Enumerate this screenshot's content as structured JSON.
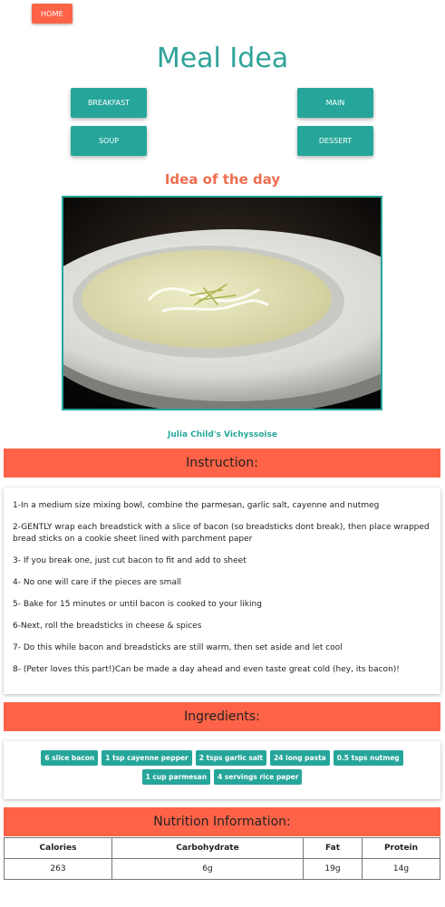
{
  "nav": {
    "home_label": "HOME"
  },
  "header": {
    "title": "Meal Idea"
  },
  "categories": [
    {
      "label": "BREAKFAST"
    },
    {
      "label": "MAIN"
    },
    {
      "label": "SOUP"
    },
    {
      "label": "DESSERT"
    }
  ],
  "idea": {
    "heading": "Idea of the day",
    "dish_name": "Julia Child's Vichyssoise"
  },
  "instructions": {
    "heading": "Instruction:",
    "steps": [
      "1-In a medium size mixing bowl, combine the parmesan, garlic salt, cayenne and nutmeg",
      "2-GENTLY wrap each breadstick with a slice of bacon (so breadsticks dont break), then place wrapped bread sticks on a cookie sheet lined with parchment paper",
      "3- If you break one, just cut bacon to fit and add to sheet",
      "4- No one will care if the pieces are small",
      "5- Bake for 15 minutes or until bacon is cooked to your liking",
      "6-Next, roll the breadsticks in cheese & spices",
      "7- Do this while bacon and breadsticks are still warm, then set aside and let cool",
      "8- (Peter loves this part!)Can be made a day ahead and even taste great cold (hey, its bacon)!"
    ]
  },
  "ingredients": {
    "heading": "Ingredients:",
    "items": [
      "6 slice bacon",
      "1 tsp cayenne pepper",
      "2 tsps garlic salt",
      "24 long pasta",
      "0.5 tsps nutmeg",
      "1 cup parmesan",
      "4 servings rice paper"
    ]
  },
  "nutrition": {
    "heading": "Nutrition Information:",
    "columns": [
      "Calories",
      "Carbohydrate",
      "Fat",
      "Protein"
    ],
    "values": [
      "263",
      "6g",
      "19g",
      "14g"
    ]
  },
  "colors": {
    "accent_teal": "#26a69a",
    "accent_tomato": "#ff6347"
  }
}
